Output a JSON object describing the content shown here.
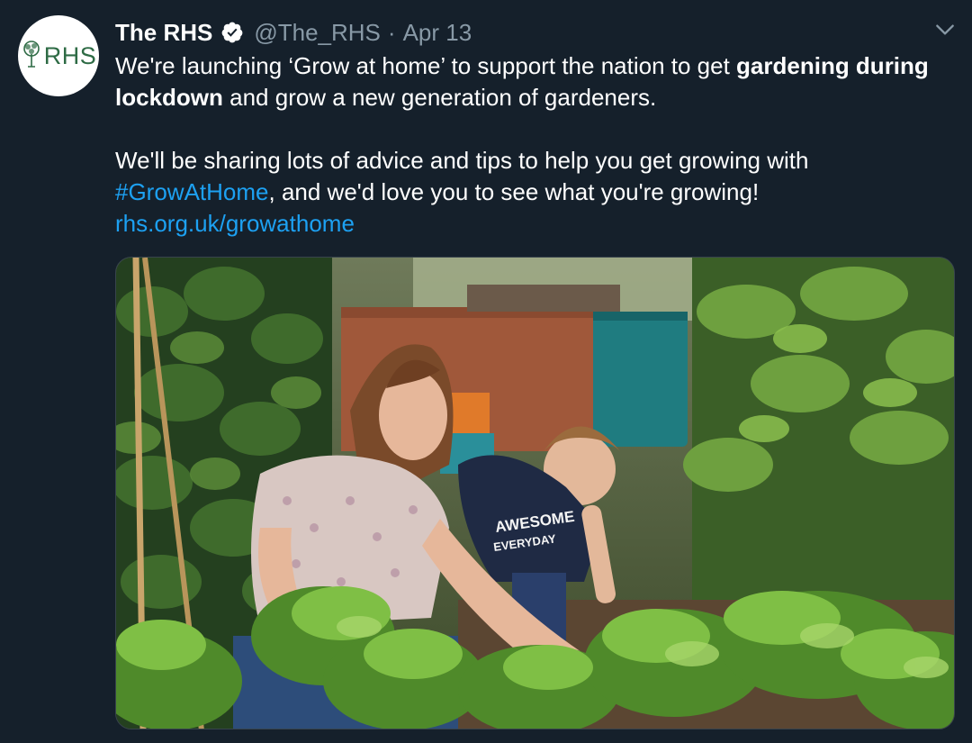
{
  "account": {
    "display_name": "The RHS",
    "handle": "@The_RHS",
    "separator": "·",
    "date": "Apr 13",
    "avatar_logo_text": "RHS"
  },
  "tweet": {
    "p1_part1": "We're launching ‘Grow at home’ to support the nation to get ",
    "p1_bold": "gardening during lockdown",
    "p1_part2": " and grow a new generation of gardeners.",
    "p2_part1": "We'll be sharing lots of advice and tips to help you get growing with ",
    "hashtag": "#GrowAtHome",
    "p2_part2": ", and we'd love you to see what you're growing!",
    "link": "rhs.org.uk/growathome"
  },
  "media": {
    "shirt_text_line1": "AWESOME",
    "shirt_text_line2": "EVERYDAY"
  },
  "colors": {
    "background": "#15202b",
    "link": "#1da1f2",
    "muted": "#8899a6",
    "logo_green": "#2e6b45"
  },
  "icons": [
    "verified-badge-icon",
    "chevron-down-icon",
    "rhs-tree-logo-icon"
  ]
}
